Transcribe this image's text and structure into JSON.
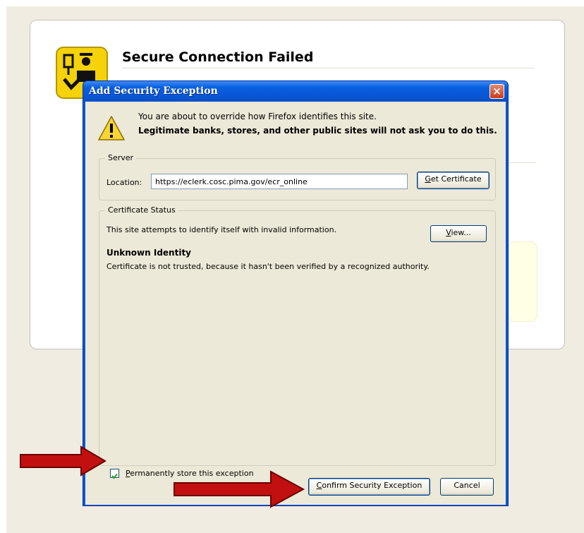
{
  "error_page": {
    "title": "Secure Connection Failed"
  },
  "dialog": {
    "title": "Add Security Exception",
    "close_label": "×",
    "intro": "You are about to override how Firefox identifies this site.",
    "intro_bold": "Legitimate banks, stores, and other public sites will not ask you to do this.",
    "server": {
      "group_label": "Server",
      "location_label": "Location:",
      "location_value": "https://eclerk.cosc.pima.gov/ecr_online",
      "get_certificate_label": "Get Certificate",
      "get_certificate_accesskey": "G"
    },
    "certificate_status": {
      "group_label": "Certificate Status",
      "status_text": "This site attempts to identify itself with invalid information.",
      "view_label": "View...",
      "view_accesskey": "V",
      "identity_heading": "Unknown Identity",
      "identity_desc": "Certificate is not trusted, because it hasn't been verified by a recognized authority."
    },
    "permanent_store": {
      "label": "Permanently store this exception",
      "accesskey": "P",
      "checked": true
    },
    "confirm_label": "Confirm Security Exception",
    "confirm_accesskey": "C",
    "cancel_label": "Cancel"
  },
  "annotations": {
    "arrow_color": "#c21010",
    "arrow_icon": "red-arrow-icon"
  },
  "colors": {
    "titlebar": "#0a5fe0",
    "dialog_face": "#ece9d8",
    "page_background": "#f0ece2"
  }
}
